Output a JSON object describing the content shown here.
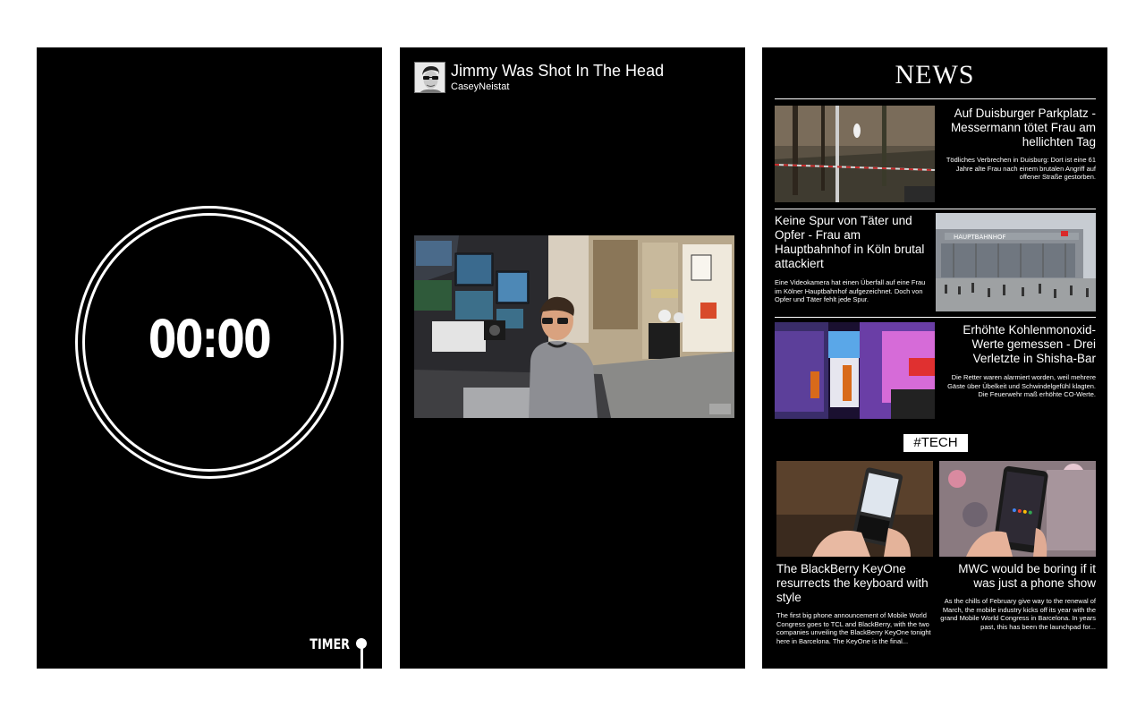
{
  "timer": {
    "time": "00:00",
    "label": "TIMER"
  },
  "video": {
    "title": "Jimmy Was Shot In The Head",
    "channel": "CaseyNeistat",
    "watermark": "YouTube"
  },
  "news": {
    "title": "NEWS",
    "articles": [
      {
        "headline": "Auf Duisburger Parkplatz - Messermann tötet Frau am hellichten Tag",
        "snippet": "Tödliches Verbrechen in Duisburg: Dort ist eine 61 Jahre alte Frau nach einem brutalen Angriff auf offener Straße gestorben."
      },
      {
        "headline": "Keine Spur von Täter und Opfer - Frau am Hauptbahnhof in Köln brutal attackiert",
        "snippet": "Eine Videokamera hat einen Überfall auf eine Frau im Kölner Hauptbahnhof aufgezeichnet. Doch von Opfer und Täter fehlt jede Spur.",
        "image_text": "HAUPTBAHNHOF"
      },
      {
        "headline": "Erhöhte Kohlenmonoxid-Werte gemessen - Drei Verletzte in Shisha-Bar",
        "snippet": "Die Retter waren alarmiert worden, weil mehrere Gäste über Übelkeit und Schwindelgefühl klagten. Die Feuerwehr maß erhöhte CO-Werte."
      }
    ],
    "tech_tag": "#TECH",
    "tech_articles": [
      {
        "headline": "The BlackBerry KeyOne resurrects the keyboard with style",
        "snippet": "The first big phone announcement of Mobile World Congress goes to TCL and BlackBerry, with the two companies unveiling the BlackBerry KeyOne tonight here in Barcelona. The KeyOne is the final..."
      },
      {
        "headline": "MWC would be boring if it was just a phone show",
        "snippet": "As the chills of February give way to the renewal of March, the mobile industry kicks off its year with the grand Mobile World Congress in Barcelona. In years past, this has been the launchpad for..."
      }
    ]
  }
}
